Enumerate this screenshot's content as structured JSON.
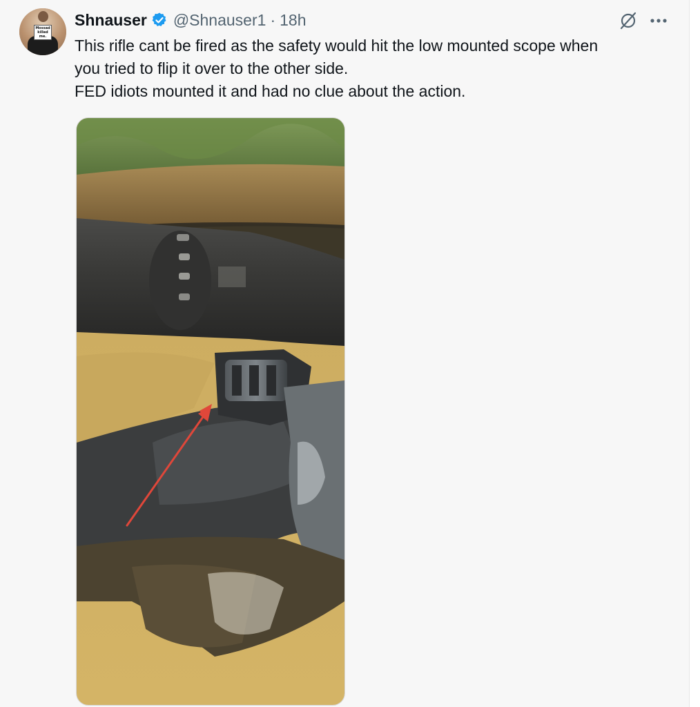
{
  "post": {
    "author_name": "Shnauser",
    "handle": "@Shnauser1",
    "separator": "·",
    "time": "18h",
    "text_lines": [
      "This rifle cant be fired as the safety would hit the low mounted scope when",
      "you tried to flip it over to the other side.",
      "FED idiots mounted it and had no clue about the action."
    ],
    "avatar_sign_text": "Mossad killed me."
  },
  "colors": {
    "verified_badge": "#1d9bf0",
    "text_primary": "#0f1419",
    "text_secondary": "#536471",
    "arrow": "#e0473a"
  },
  "icons": {
    "verified": "verified-badge-icon",
    "grok": "grok-icon",
    "more": "more-icon"
  }
}
